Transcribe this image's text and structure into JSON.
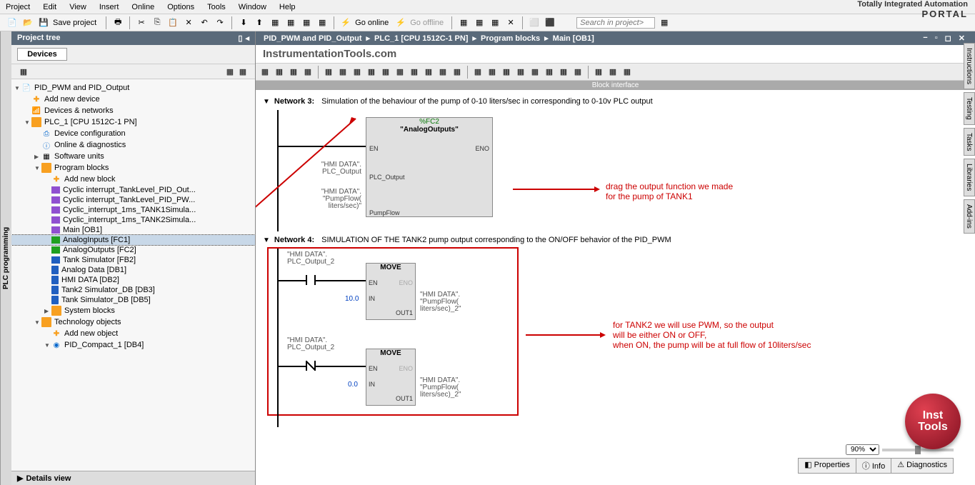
{
  "menu": [
    "Project",
    "Edit",
    "View",
    "Insert",
    "Online",
    "Options",
    "Tools",
    "Window",
    "Help"
  ],
  "branding": {
    "line1": "Totally Integrated Automation",
    "line2": "PORTAL"
  },
  "toolbar1": {
    "save": "Save project",
    "go_online": "Go online",
    "go_offline": "Go offline",
    "search": "Search in project>"
  },
  "project_tree": {
    "title": "Project tree",
    "tab": "Devices"
  },
  "side_tab": "PLC programming",
  "tree": {
    "root": "PID_PWM and PID_Output",
    "add_device": "Add new device",
    "devnet": "Devices & networks",
    "plc": "PLC_1 [CPU 1512C-1 PN]",
    "dev_cfg": "Device configuration",
    "online_diag": "Online & diagnostics",
    "sw_units": "Software units",
    "prog_blocks": "Program blocks",
    "add_block": "Add new block",
    "ob1": "Cyclic interrupt_TankLevel_PID_Out...",
    "ob2": "Cyclic interrupt_TankLevel_PID_PW...",
    "ob3": "Cyclic_interrupt_1ms_TANK1Simula...",
    "ob4": "Cyclic_interrupt_1ms_TANK2Simula...",
    "ob5": "Main [OB1]",
    "fc1": "AnalogInputs [FC1]",
    "fc2": "AnalogOutputs [FC2]",
    "fb2": "Tank Simulator [FB2]",
    "db1": "Analog Data [DB1]",
    "db2": "HMI DATA [DB2]",
    "db3": "Tank2 Simulator_DB [DB3]",
    "db5": "Tank Simulator_DB [DB5]",
    "sys_blocks": "System blocks",
    "tech_obj": "Technology objects",
    "add_obj": "Add new object",
    "pid_comp": "PID_Compact_1 [DB4]"
  },
  "details": "Details view",
  "crumb": [
    "PID_PWM and PID_Output",
    "PLC_1 [CPU 1512C-1 PN]",
    "Program blocks",
    "Main [OB1]"
  ],
  "watermark": "InstrumentationTools.com",
  "block_interface": "Block interface",
  "net3": {
    "label": "Network 3:",
    "comment": "Simulation of the behaviour of the pump of 0-10 liters/sec in corresponding to 0-10v PLC output",
    "fc": "%FC2",
    "name": "\"AnalogOutputs\"",
    "en": "EN",
    "eno": "ENO",
    "pin1": "PLC_Output",
    "pin2": "PumpFlow",
    "io1a": "\"HMI DATA\".",
    "io1b": "PLC_Output",
    "io2a": "\"HMI DATA\".",
    "io2b": "\"PumpFlow(",
    "io2c": "liters/sec)\""
  },
  "net4": {
    "label": "Network 4:",
    "comment": "SIMULATION OF THE TANK2 pump output corresponding to the ON/OFF behavior of the PID_PWM",
    "move": "MOVE",
    "en": "EN",
    "eno": "ENO",
    "in": "IN",
    "out": "OUT1",
    "var1": "\"HMI DATA\".",
    "var2": "PLC_Output_2",
    "c1": "10.0",
    "c2": "0.0",
    "out1": "\"HMI DATA\".",
    "out2": "\"PumpFlow(",
    "out3": "liters/sec)_2\""
  },
  "annot1a": "drag the output function we made",
  "annot1b": "for the pump of TANK1",
  "annot2a": "for TANK2 we will use PWM, so the output",
  "annot2b": "will be either ON or OFF,",
  "annot2c": "when ON, the pump will be at full flow of 10liters/sec",
  "zoom": "90%",
  "tabs": {
    "prop": "Properties",
    "info": "Info",
    "diag": "Diagnostics"
  },
  "logo": {
    "l1": "Inst",
    "l2": "Tools"
  },
  "rtabs": [
    "Instructions",
    "Testing",
    "Tasks",
    "Libraries",
    "Add-ins"
  ]
}
